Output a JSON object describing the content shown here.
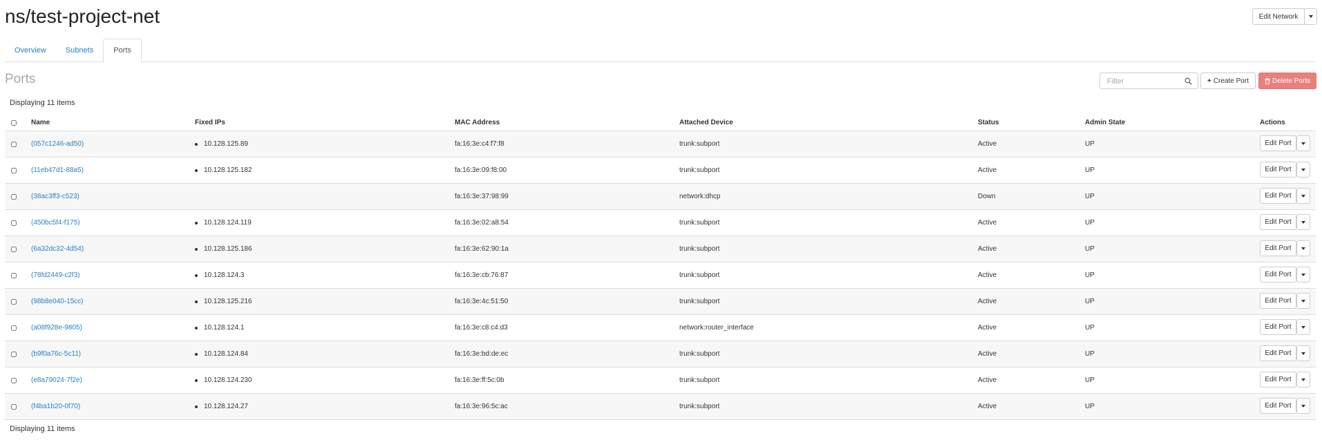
{
  "page": {
    "title": "ns/test-project-net"
  },
  "header": {
    "edit_network_label": "Edit Network"
  },
  "tabs": [
    {
      "label": "Overview",
      "active": false
    },
    {
      "label": "Subnets",
      "active": false
    },
    {
      "label": "Ports",
      "active": true
    }
  ],
  "ports_section": {
    "title": "Ports",
    "filter_placeholder": "Filter",
    "create_label": "Create Port",
    "create_icon": "plus-icon",
    "delete_label": "Delete Ports",
    "delete_icon": "trash-icon",
    "delete_color": "#e8807d",
    "count_text": "Displaying 11 items"
  },
  "columns": [
    "Name",
    "Fixed IPs",
    "MAC Address",
    "Attached Device",
    "Status",
    "Admin State",
    "Actions"
  ],
  "rows": [
    {
      "name": "(057c1246-ad50)",
      "fixed_ip": "10.128.125.89",
      "mac": "fa:16:3e:c4:f7:f8",
      "device": "trunk:subport",
      "status": "Active",
      "admin_state": "UP",
      "action": "Edit Port"
    },
    {
      "name": "(11eb47d1-88a5)",
      "fixed_ip": "10.128.125.182",
      "mac": "fa:16:3e:09:f8:00",
      "device": "trunk:subport",
      "status": "Active",
      "admin_state": "UP",
      "action": "Edit Port"
    },
    {
      "name": "(38ac3ff3-c523)",
      "fixed_ip": "",
      "mac": "fa:16:3e:37:98:99",
      "device": "network:dhcp",
      "status": "Down",
      "admin_state": "UP",
      "action": "Edit Port"
    },
    {
      "name": "(450bc5f4-f175)",
      "fixed_ip": "10.128.124.119",
      "mac": "fa:16:3e:02:a8:54",
      "device": "trunk:subport",
      "status": "Active",
      "admin_state": "UP",
      "action": "Edit Port"
    },
    {
      "name": "(6a32dc32-4d54)",
      "fixed_ip": "10.128.125.186",
      "mac": "fa:16:3e:62:90:1a",
      "device": "trunk:subport",
      "status": "Active",
      "admin_state": "UP",
      "action": "Edit Port"
    },
    {
      "name": "(78fd2449-c2f3)",
      "fixed_ip": "10.128.124.3",
      "mac": "fa:16:3e:cb:76:87",
      "device": "trunk:subport",
      "status": "Active",
      "admin_state": "UP",
      "action": "Edit Port"
    },
    {
      "name": "(98b8e040-15cc)",
      "fixed_ip": "10.128.125.216",
      "mac": "fa:16:3e:4c:51:50",
      "device": "trunk:subport",
      "status": "Active",
      "admin_state": "UP",
      "action": "Edit Port"
    },
    {
      "name": "(a08f928e-9805)",
      "fixed_ip": "10.128.124.1",
      "mac": "fa:16:3e:c8:c4:d3",
      "device": "network:router_interface",
      "status": "Active",
      "admin_state": "UP",
      "action": "Edit Port"
    },
    {
      "name": "(b9f0a76c-5c11)",
      "fixed_ip": "10.128.124.84",
      "mac": "fa:16:3e:bd:de:ec",
      "device": "trunk:subport",
      "status": "Active",
      "admin_state": "UP",
      "action": "Edit Port"
    },
    {
      "name": "(e8a79024-7f2e)",
      "fixed_ip": "10.128.124.230",
      "mac": "fa:16:3e:ff:5c:0b",
      "device": "trunk:subport",
      "status": "Active",
      "admin_state": "UP",
      "action": "Edit Port"
    },
    {
      "name": "(f4ba1b20-0f70)",
      "fixed_ip": "10.128.124.27",
      "mac": "fa:16:3e:96:5c:ac",
      "device": "trunk:subport",
      "status": "Active",
      "admin_state": "UP",
      "action": "Edit Port"
    }
  ]
}
